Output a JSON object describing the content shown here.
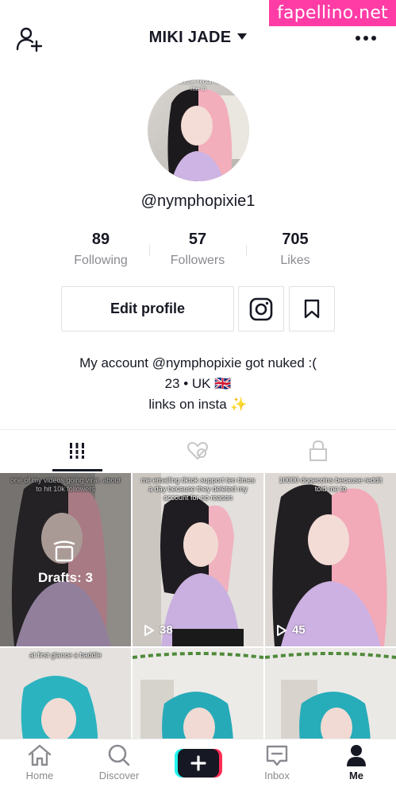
{
  "watermark": "fapellino.net",
  "header": {
    "username": "MIKI JADE",
    "add_user_icon": "add-user-icon",
    "more_icon": "more-dots-icon"
  },
  "profile": {
    "handle": "@nymphopixie1",
    "avatar_caption": "because reddit told me to",
    "stats": [
      {
        "value": "89",
        "label": "Following"
      },
      {
        "value": "57",
        "label": "Followers"
      },
      {
        "value": "705",
        "label": "Likes"
      }
    ],
    "edit_label": "Edit profile",
    "bio_lines": [
      "My account @nymphopixie got nuked :(",
      "23 • UK 🇬🇧",
      "links on insta ✨"
    ]
  },
  "tabs": [
    {
      "icon": "grid-icon",
      "active": true
    },
    {
      "icon": "hidden-likes-icon",
      "active": false
    },
    {
      "icon": "lock-icon",
      "active": false
    }
  ],
  "videos": [
    {
      "caption": "one of my videos going viral, about to hit 10k followers",
      "drafts": "Drafts: 3"
    },
    {
      "caption": "me emailing tiktok support ten times a day because they deleted my account for no reason",
      "views": "38"
    },
    {
      "caption": "10000 dogecoins because reddit told me to",
      "views": "45"
    },
    {
      "caption": "at first glance a baddie"
    },
    {
      "caption": ""
    },
    {
      "caption": ""
    }
  ],
  "nav": [
    {
      "label": "Home",
      "icon": "home-icon"
    },
    {
      "label": "Discover",
      "icon": "search-icon"
    },
    {
      "label": "",
      "icon": "create-plus-icon"
    },
    {
      "label": "Inbox",
      "icon": "inbox-icon"
    },
    {
      "label": "Me",
      "icon": "profile-icon",
      "active": true
    }
  ],
  "colors": {
    "accent_pink": "#ff3ca6",
    "text": "#161823",
    "muted": "#8a8b91",
    "tiktok_cyan": "#25f4ee",
    "tiktok_red": "#fe2c55"
  }
}
